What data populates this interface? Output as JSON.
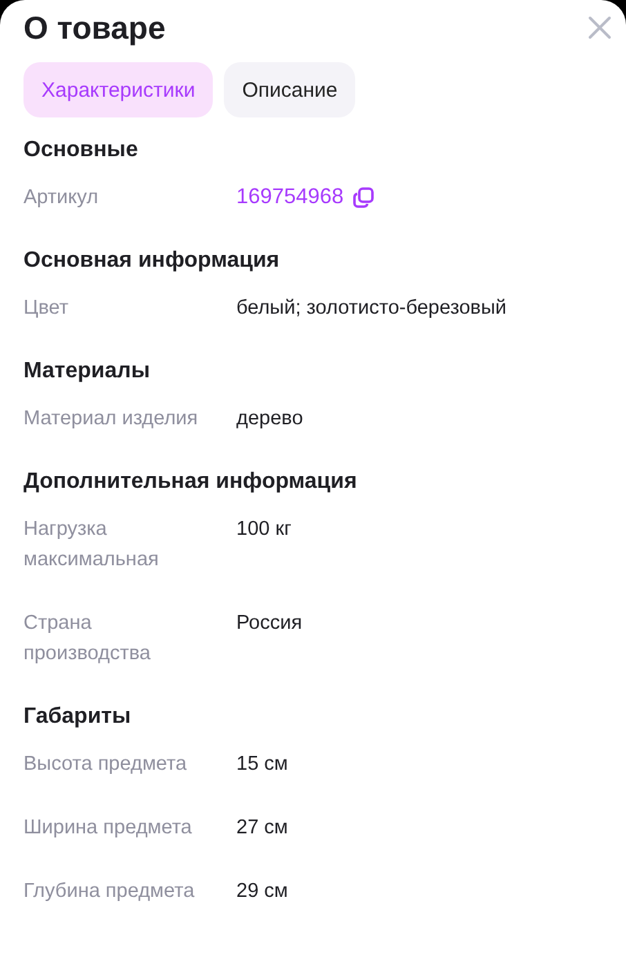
{
  "title": "О товаре",
  "tabs": [
    {
      "label": "Характеристики",
      "selected": true
    },
    {
      "label": "Описание",
      "selected": false
    }
  ],
  "sections": [
    {
      "heading": "Основные",
      "rows": [
        {
          "label": "Артикул",
          "value": "169754968",
          "kind": "copyable"
        }
      ]
    },
    {
      "heading": "Основная информация",
      "rows": [
        {
          "label": "Цвет",
          "value": "белый; золотисто-березовый",
          "kind": "text"
        }
      ]
    },
    {
      "heading": "Материалы",
      "rows": [
        {
          "label": "Материал изделия",
          "value": "дерево",
          "kind": "text"
        }
      ]
    },
    {
      "heading": "Дополнительная информация",
      "rows": [
        {
          "label": "Нагрузка максимальная",
          "value": "100 кг",
          "kind": "text"
        },
        {
          "label": "Страна производства",
          "value": "Россия",
          "kind": "text"
        }
      ]
    },
    {
      "heading": "Габариты",
      "rows": [
        {
          "label": "Высота предмета",
          "value": "15 см",
          "kind": "text"
        },
        {
          "label": "Ширина предмета",
          "value": "27 см",
          "kind": "text"
        },
        {
          "label": "Глубина предмета",
          "value": "29 см",
          "kind": "text"
        }
      ]
    }
  ]
}
